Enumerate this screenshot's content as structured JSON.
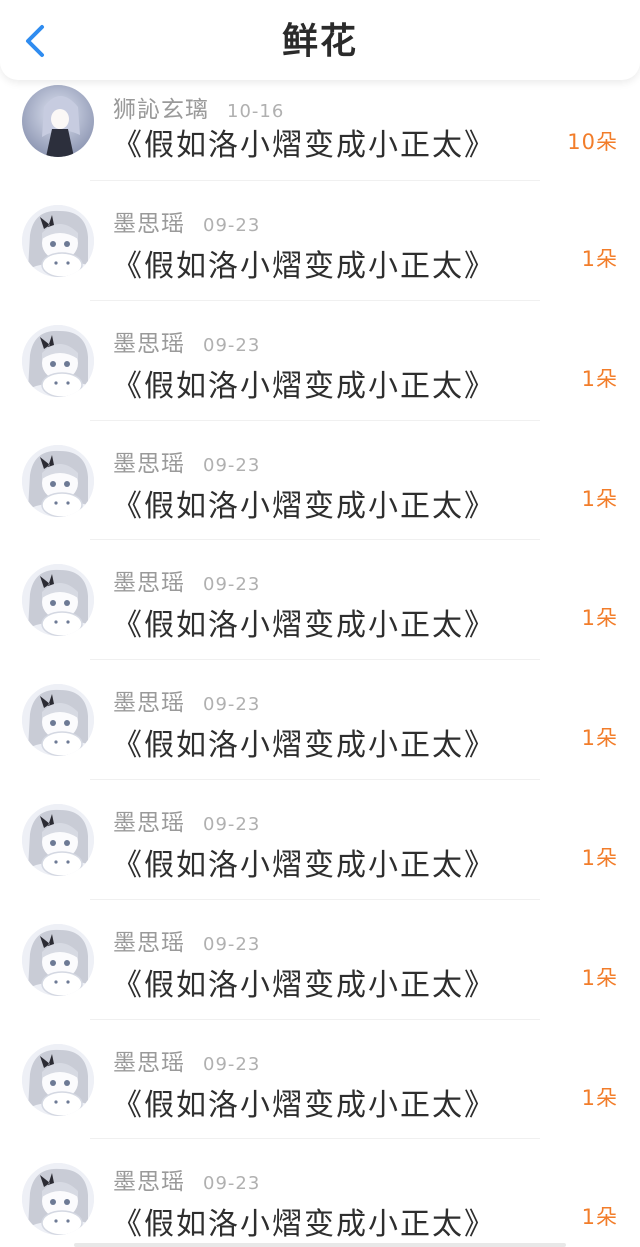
{
  "header": {
    "title": "鲜花",
    "back_icon": "chevron-left-icon",
    "back_color": "#2f8cf0"
  },
  "items": [
    {
      "name": "狮訫玄璃",
      "date": "10-16",
      "work": "《假如洛小熠变成小正太》",
      "amount": "10朵",
      "avatar": "first"
    },
    {
      "name": "墨思瑶",
      "date": "09-23",
      "work": "《假如洛小熠变成小正太》",
      "amount": "1朵",
      "avatar": "repeat"
    },
    {
      "name": "墨思瑶",
      "date": "09-23",
      "work": "《假如洛小熠变成小正太》",
      "amount": "1朵",
      "avatar": "repeat"
    },
    {
      "name": "墨思瑶",
      "date": "09-23",
      "work": "《假如洛小熠变成小正太》",
      "amount": "1朵",
      "avatar": "repeat"
    },
    {
      "name": "墨思瑶",
      "date": "09-23",
      "work": "《假如洛小熠变成小正太》",
      "amount": "1朵",
      "avatar": "repeat"
    },
    {
      "name": "墨思瑶",
      "date": "09-23",
      "work": "《假如洛小熠变成小正太》",
      "amount": "1朵",
      "avatar": "repeat"
    },
    {
      "name": "墨思瑶",
      "date": "09-23",
      "work": "《假如洛小熠变成小正太》",
      "amount": "1朵",
      "avatar": "repeat"
    },
    {
      "name": "墨思瑶",
      "date": "09-23",
      "work": "《假如洛小熠变成小正太》",
      "amount": "1朵",
      "avatar": "repeat"
    },
    {
      "name": "墨思瑶",
      "date": "09-23",
      "work": "《假如洛小熠变成小正太》",
      "amount": "1朵",
      "avatar": "repeat"
    },
    {
      "name": "墨思瑶",
      "date": "09-23",
      "work": "《假如洛小熠变成小正太》",
      "amount": "1朵",
      "avatar": "repeat"
    }
  ],
  "colors": {
    "accent": "#f27d2a",
    "name_text": "#9a9a9a",
    "date_text": "#b0b0b0",
    "work_text": "#2e2e2e"
  }
}
